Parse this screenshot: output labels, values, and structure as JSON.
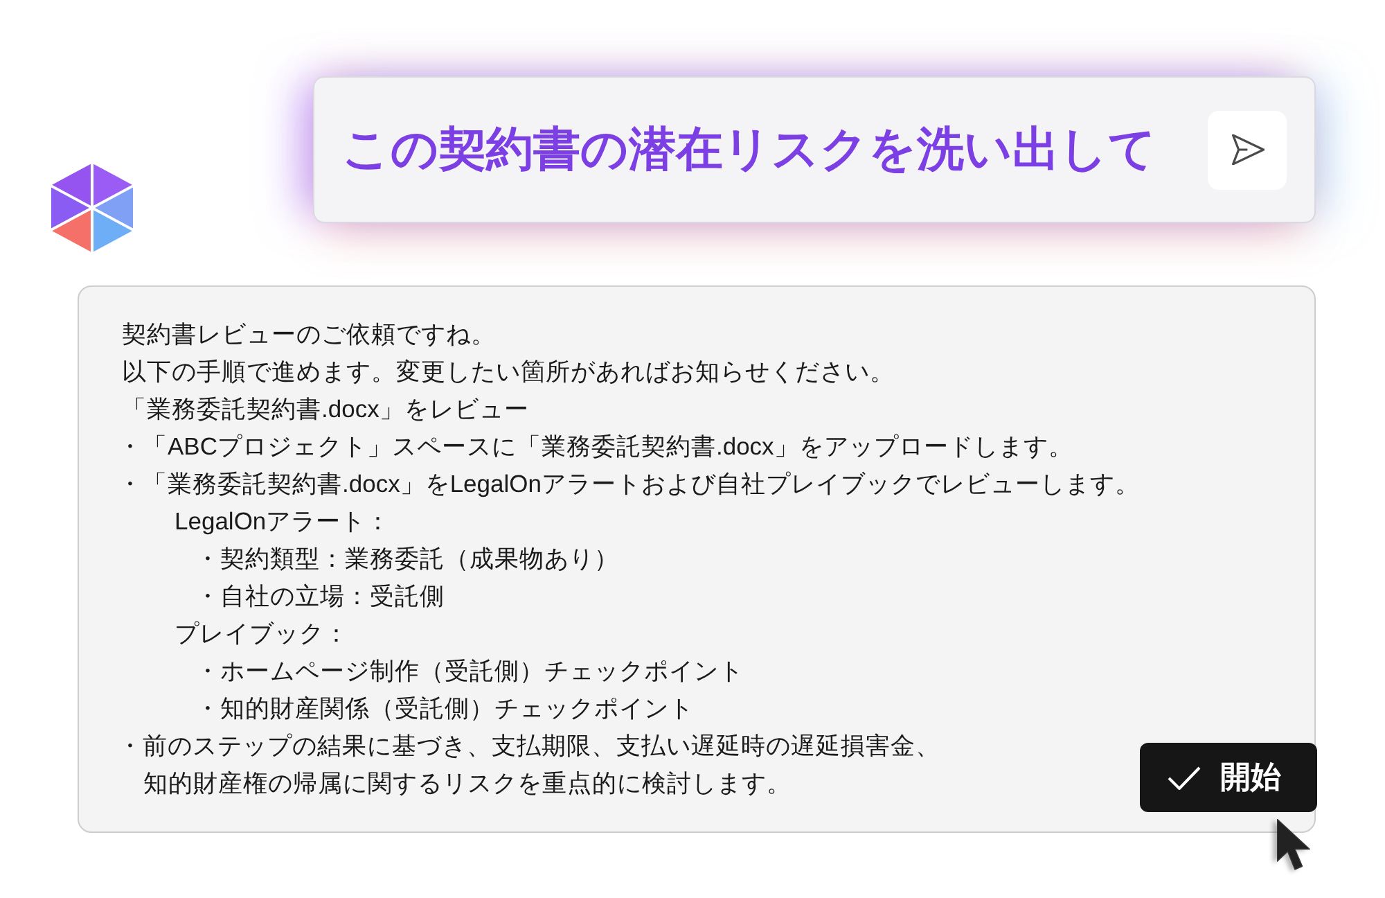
{
  "prompt": {
    "value": "この契約書の潜在リスクを洗い出して"
  },
  "response": {
    "intro": [
      "契約書レビューのご依頼ですね。",
      "以下の手順で進めます。変更したい箇所があればお知らせください。"
    ],
    "plan_title": "「業務委託契約書.docx」をレビュー",
    "steps": [
      {
        "text": "・「ABCプロジェクト」スペースに「業務委託契約書.docx」をアップロードします。"
      },
      {
        "text": "・「業務委託契約書.docx」をLegalOnアラートおよび自社プレイブックでレビューします。",
        "children": [
          {
            "text": "LegalOnアラート：",
            "children": [
              {
                "text": "・契約類型：業務委託（成果物あり）"
              },
              {
                "text": "・自社の立場：受託側"
              }
            ]
          },
          {
            "text": "プレイブック：",
            "children": [
              {
                "text": "・ホームページ制作（受託側）チェックポイント"
              },
              {
                "text": "・知的財産関係（受託側）チェックポイント"
              }
            ]
          }
        ]
      },
      {
        "lines": [
          "・前のステップの結果に基づき、支払期限、支払い遅延時の遅延損害金、",
          "知的財産権の帰属に関するリスクを重点的に検討します。"
        ]
      }
    ],
    "start_button": {
      "label": "開始"
    }
  }
}
